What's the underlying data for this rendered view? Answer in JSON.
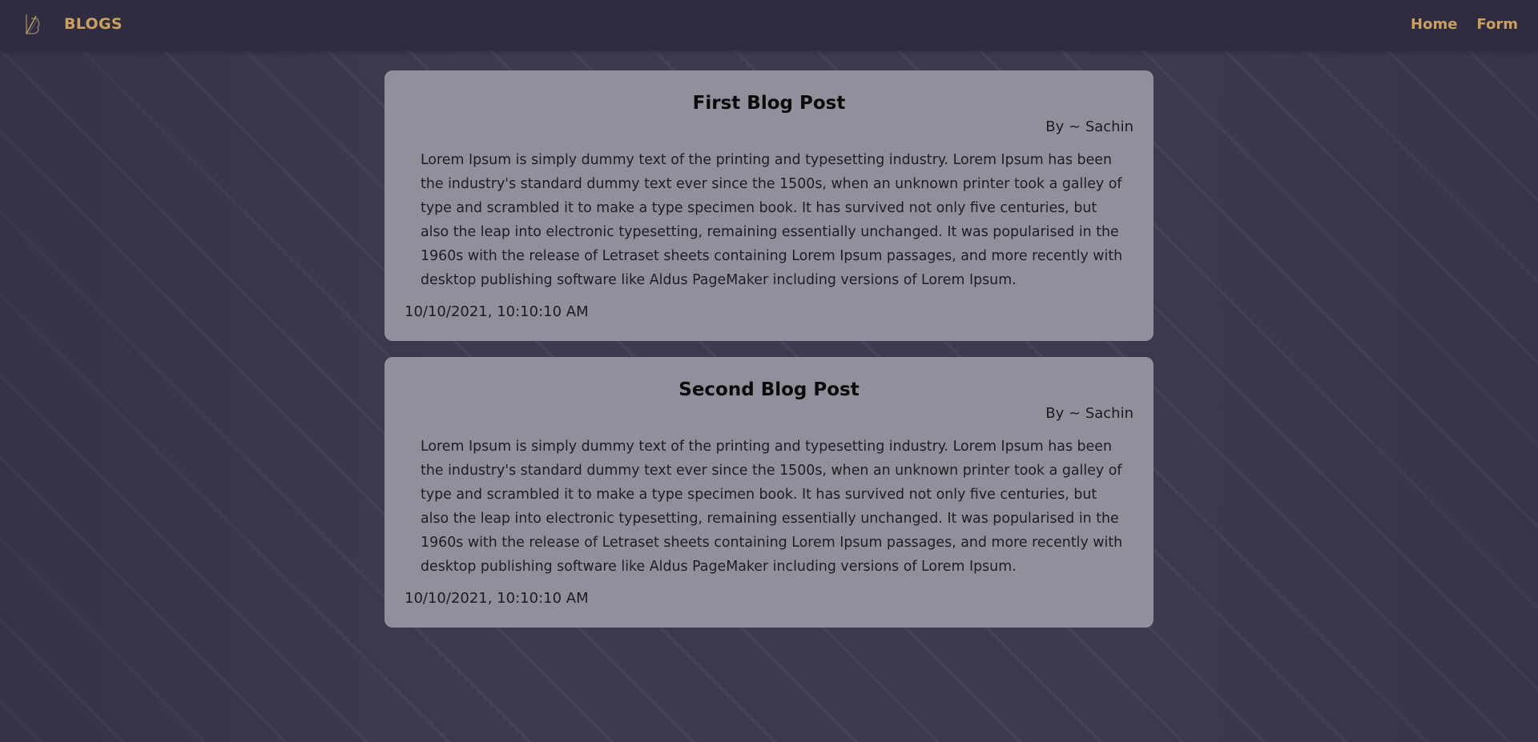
{
  "navbar": {
    "logo_icon": "blog-logo-icon",
    "brand": "BLOGS",
    "links": [
      {
        "label": "Home"
      },
      {
        "label": "Form"
      }
    ],
    "accent_color": "#c9a062"
  },
  "posts": [
    {
      "title": "First Blog Post",
      "author": "By ~ Sachin",
      "body": "Lorem Ipsum is simply dummy text of the printing and typesetting industry. Lorem Ipsum has been the industry's standard dummy text ever since the 1500s, when an unknown printer took a galley of type and scrambled it to make a type specimen book. It has survived not only five centuries, but also the leap into electronic typesetting, remaining essentially unchanged. It was popularised in the 1960s with the release of Letraset sheets containing Lorem Ipsum passages, and more recently with desktop publishing software like Aldus PageMaker including versions of Lorem Ipsum.",
      "date": "10/10/2021, 10:10:10 AM"
    },
    {
      "title": "Second Blog Post",
      "author": "By ~ Sachin",
      "body": "Lorem Ipsum is simply dummy text of the printing and typesetting industry. Lorem Ipsum has been the industry's standard dummy text ever since the 1500s, when an unknown printer took a galley of type and scrambled it to make a type specimen book. It has survived not only five centuries, but also the leap into electronic typesetting, remaining essentially unchanged. It was popularised in the 1960s with the release of Letraset sheets containing Lorem Ipsum passages, and more recently with desktop publishing software like Aldus PageMaker including versions of Lorem Ipsum.",
      "date": "10/10/2021, 10:10:10 AM"
    }
  ]
}
